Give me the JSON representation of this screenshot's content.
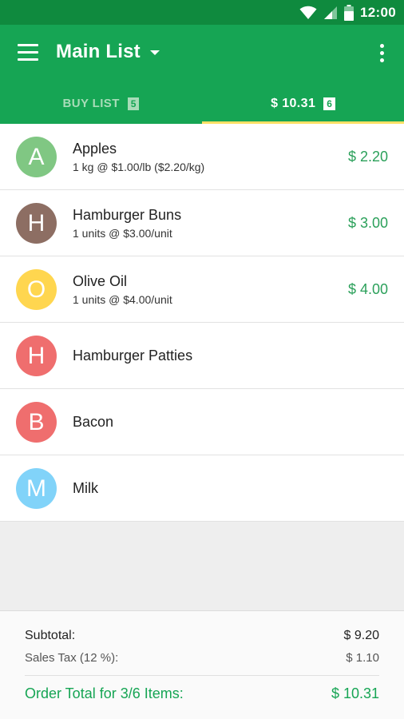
{
  "status_bar": {
    "time": "12:00",
    "icons": [
      "wifi-icon",
      "signal-icon",
      "battery-icon"
    ]
  },
  "toolbar": {
    "title": "Main List",
    "icons": [
      "menu-icon",
      "dropdown-icon",
      "overflow-icon"
    ]
  },
  "tabs": [
    {
      "label": "BUY LIST",
      "badge": "5"
    },
    {
      "label": "$ 10.31",
      "badge": "6"
    }
  ],
  "colors": {
    "status_bar": "#0f8a3e",
    "primary": "#16a554",
    "tab_indicator": "#ffe066",
    "price": "#2ba05a"
  },
  "items": [
    {
      "letter": "A",
      "name": "Apples",
      "detail": "1 kg @ $1.00/lb ($2.20/kg)",
      "price": "$ 2.20",
      "color": "#80c783"
    },
    {
      "letter": "H",
      "name": "Hamburger Buns",
      "detail": "1 units @ $3.00/unit",
      "price": "$ 3.00",
      "color": "#8d6e63"
    },
    {
      "letter": "O",
      "name": "Olive Oil",
      "detail": "1 units @ $4.00/unit",
      "price": "$ 4.00",
      "color": "#ffd64f"
    },
    {
      "letter": "H",
      "name": "Hamburger Patties",
      "detail": "",
      "price": "",
      "color": "#ef6e6e"
    },
    {
      "letter": "B",
      "name": "Bacon",
      "detail": "",
      "price": "",
      "color": "#ef6e6e"
    },
    {
      "letter": "M",
      "name": "Milk",
      "detail": "",
      "price": "",
      "color": "#81d3f9"
    }
  ],
  "summary": {
    "subtotal_label": "Subtotal:",
    "subtotal_value": "$ 9.20",
    "tax_label": "Sales Tax (12 %):",
    "tax_value": "$ 1.10",
    "total_label": "Order Total for 3/6 Items:",
    "total_value": "$ 10.31"
  }
}
